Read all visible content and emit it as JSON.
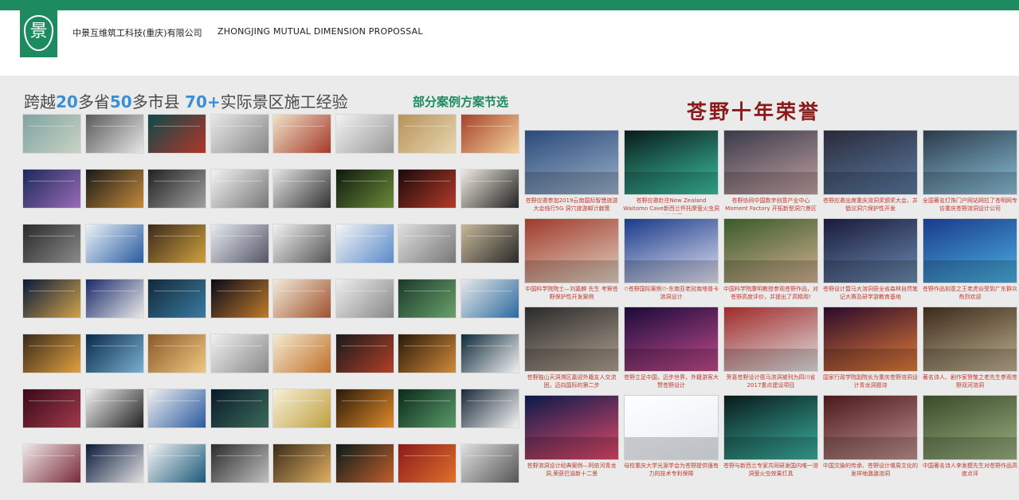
{
  "header": {
    "logo_glyph": "景",
    "company": "中景互维筑工科技(重庆)有限公司",
    "proposal": "ZHONGJING MUTUAL DIMENSION  PROPOSSAL"
  },
  "left": {
    "headline_a": "跨越",
    "headline_b": "20",
    "headline_c": "多省",
    "headline_d": "50",
    "headline_e": "多市县  ",
    "headline_f": "70+",
    "headline_g": "实际景区施工经验",
    "subhead": "部分案例方案节选",
    "cases": [
      {
        "c1": "#7fa3a3",
        "c2": "#c9d3c2"
      },
      {
        "c1": "#5a5a5a",
        "c2": "#e6e6e6"
      },
      {
        "c1": "#0e4a4a",
        "c2": "#b0352a"
      },
      {
        "c1": "#e8e8e8",
        "c2": "#888"
      },
      {
        "c1": "#f0e2c8",
        "c2": "#a53a2a"
      },
      {
        "c1": "#f2f2f2",
        "c2": "#999"
      },
      {
        "c1": "#b7925a",
        "c2": "#e7d6b0"
      },
      {
        "c1": "#a8422a",
        "c2": "#f2d29a"
      },
      {
        "c1": "#1b2a5a",
        "c2": "#9a6bb7"
      },
      {
        "c1": "#1a1a1a",
        "c2": "#c48a3a"
      },
      {
        "c1": "#222",
        "c2": "#a0a0a0"
      },
      {
        "c1": "#f4f4f4",
        "c2": "#777"
      },
      {
        "c1": "#e6e6e6",
        "c2": "#333"
      },
      {
        "c1": "#0e1a0e",
        "c2": "#6b8a3a"
      },
      {
        "c1": "#1a0a0a",
        "c2": "#b33a2a"
      },
      {
        "c1": "#f0ebe0",
        "c2": "#222"
      },
      {
        "c1": "#2a2a2a",
        "c2": "#8a8a8a"
      },
      {
        "c1": "#e9f3f8",
        "c2": "#2a5aa0"
      },
      {
        "c1": "#3a2a1a",
        "c2": "#d0a040"
      },
      {
        "c1": "#e6ecf2",
        "c2": "#556"
      },
      {
        "c1": "#f2f2f2",
        "c2": "#555"
      },
      {
        "c1": "#f6f6f6",
        "c2": "#5a8acb"
      },
      {
        "c1": "#e0e0e0",
        "c2": "#777"
      },
      {
        "c1": "#c7b89a",
        "c2": "#2a2a2a"
      },
      {
        "c1": "#0a1a3a",
        "c2": "#d0a24a"
      },
      {
        "c1": "#1a2a6a",
        "c2": "#e9e9e9"
      },
      {
        "c1": "#122a3a",
        "c2": "#3a7aa0"
      },
      {
        "c1": "#0a0a1a",
        "c2": "#c07a2a"
      },
      {
        "c1": "#f2ead8",
        "c2": "#a0522d"
      },
      {
        "c1": "#eee",
        "c2": "#888"
      },
      {
        "c1": "#1a3a2a",
        "c2": "#6aa06a"
      },
      {
        "c1": "#e8e8e8",
        "c2": "#2a6aa0"
      },
      {
        "c1": "#3a2a1a",
        "c2": "#e0a040"
      },
      {
        "c1": "#0a2a4a",
        "c2": "#7ab0d0"
      },
      {
        "c1": "#8a5a2a",
        "c2": "#f0c880"
      },
      {
        "c1": "#f0f0f0",
        "c2": "#8a8a8a"
      },
      {
        "c1": "#f4ead0",
        "c2": "#c0702a"
      },
      {
        "c1": "#1a1a1a",
        "c2": "#b0402a"
      },
      {
        "c1": "#2a1a0a",
        "c2": "#d08a3a"
      },
      {
        "c1": "#0e2a3a",
        "c2": "#f0f0f0"
      },
      {
        "c1": "#3a0a1a",
        "c2": "#a03a4a"
      },
      {
        "c1": "#f2f2f2",
        "c2": "#222"
      },
      {
        "c1": "#f0f0f0",
        "c2": "#2a5aa0"
      },
      {
        "c1": "#0a1a2a",
        "c2": "#3a6a5a"
      },
      {
        "c1": "#f6f0d8",
        "c2": "#c0a040"
      },
      {
        "c1": "#2a1a0a",
        "c2": "#e08a2a"
      },
      {
        "c1": "#0a2a1a",
        "c2": "#5a9a6a"
      },
      {
        "c1": "#1a2a3a",
        "c2": "#f4f4f4"
      },
      {
        "c1": "#f0e8e8",
        "c2": "#7a2a3a"
      },
      {
        "c1": "#0a1a3a",
        "c2": "#e0e0e0"
      },
      {
        "c1": "#f4f4f4",
        "c2": "#1a5a7a"
      },
      {
        "c1": "#2a2a2a",
        "c2": "#c0c0c0"
      },
      {
        "c1": "#3a2a1a",
        "c2": "#e0b060"
      },
      {
        "c1": "#0a1a1a",
        "c2": "#c0602a"
      },
      {
        "c1": "#8a1a1a",
        "c2": "#e0702a"
      },
      {
        "c1": "#e0e0e0",
        "c2": "#555"
      }
    ]
  },
  "right": {
    "title": "苍野十年荣誉",
    "honors": [
      {
        "c1": "#2a4a7a",
        "c2": "#9ab0c8",
        "cap": "苍野应邀参加2019云南国际智慧旅游大会线行5G 洞穴旅游邮计献策"
      },
      {
        "c1": "#0a1a1a",
        "c2": "#3ac0a0",
        "cap": "苍野应邀赴往New Zealand Waitomo Cave新西兰怀托摩萤火虫洞交流学习"
      },
      {
        "c1": "#3a3a4a",
        "c2": "#c0a0a0",
        "cap": "苍野协同中国数字创意产业中心Moment Factory 开拓新型洞穴景区"
      },
      {
        "c1": "#2a2a3a",
        "c2": "#5a7aa0",
        "cap": "苍野应邀出席重庆溶洞奖颁奖大会，并倡议洞穴保护性开发"
      },
      {
        "c1": "#2a3a4a",
        "c2": "#8ac0d8",
        "cap": "全国著名灯饰门户网站网拉了苍明网专访重庆苍野溶洞设计公司"
      },
      {
        "c1": "#a03a2a",
        "c2": "#e0d0c0",
        "cap": "中国科学院院士—刘嘉麒 先生 考察苍野保护性开发案例"
      },
      {
        "c1": "#1a3a8a",
        "c2": "#e0e0f0",
        "cap": "✩苍野国际案例✩-东南亚老挝南塔普卡溶洞设计"
      },
      {
        "c1": "#3a5a2a",
        "c2": "#d0b090",
        "cap": "中国科学院康明教授参观苍野作品，对苍野高度评价，并提出了高精用!"
      },
      {
        "c1": "#1a1a3a",
        "c2": "#6a8ab0",
        "cap": "苍野设计暨马大溶洞获全省森林自然笔记大赛及研学游教育基地"
      },
      {
        "c1": "#1a3a8a",
        "c2": "#4ab0e0",
        "cap": "苍野作品刻意之王老虎谷受到广东群众热烈欢迎"
      },
      {
        "c1": "#2a2a2a",
        "c2": "#b0a090",
        "cap": "苍野独山天洞溯区嘉迎外籍友人交流团，迈向国际的第二步"
      },
      {
        "c1": "#1a0a3a",
        "c2": "#c04a8a",
        "cap": "苍野立足中国，迈步世界，外籍游客大赞苍野设计"
      },
      {
        "c1": "#a02a2a",
        "c2": "#e0e0e0",
        "cap": "贺喜苍野设计德马溶洞被列为四川省2017重点建设项目"
      },
      {
        "c1": "#2a0a2a",
        "c2": "#e07a3a",
        "cap": "国家行政学院副院长为重庆苍野溶洞设计青龙洞题诗"
      },
      {
        "c1": "#3a2a1a",
        "c2": "#c0b090",
        "cap": "著名诗人、剧作家贺敬之老先生参观苍野双河溶洞"
      },
      {
        "c1": "#0a1a4a",
        "c2": "#e04a6a",
        "cap": "苍野溶洞设计经典案例—阿依河青龙洞,荣获巴渝新十二景"
      },
      {
        "c1": "#ffffff",
        "c2": "#e8ecf4",
        "cap": "母校重庆大学光源学会为苍野提供强有力的技术专利保障"
      },
      {
        "c1": "#0a1a1a",
        "c2": "#3ab0a0",
        "cap": "苍野与新西兰专家共同研发国内唯一溶洞萤火虫效果灯具"
      },
      {
        "c1": "#4a1a1a",
        "c2": "#c09090",
        "cap": "中国文脉的传承、苍野设计堪周文化的发祥地潞潞溶洞"
      },
      {
        "c1": "#3a4a2a",
        "c2": "#9ab080",
        "cap": "中国著名诗人李发模先生对苍野作品高度点评"
      }
    ]
  }
}
